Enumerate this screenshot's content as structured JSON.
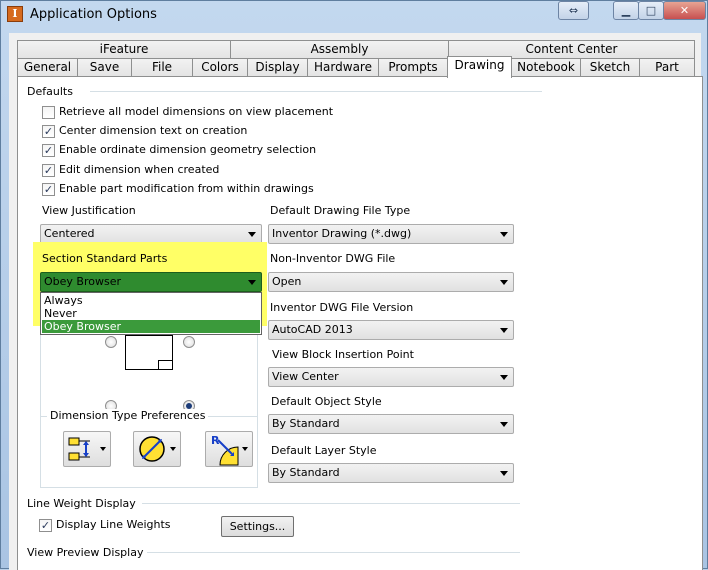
{
  "window": {
    "title": "Application Options",
    "app_icon": "I"
  },
  "caption": {
    "restore_glyph": "⇔",
    "minimize_glyph": "▁",
    "maximize_glyph": "□",
    "close_glyph": "✕"
  },
  "tabs_row1": [
    "iFeature",
    "Assembly",
    "Content Center"
  ],
  "tabs_row2": [
    "General",
    "Save",
    "File",
    "Colors",
    "Display",
    "Hardware",
    "Prompts",
    "Drawing",
    "Notebook",
    "Sketch",
    "Part"
  ],
  "active_tab": "Drawing",
  "defaults": {
    "group_label": "Defaults",
    "checkboxes": [
      {
        "label": "Retrieve all model dimensions on view placement",
        "checked": false
      },
      {
        "label": "Center dimension text on creation",
        "checked": true
      },
      {
        "label": "Enable ordinate dimension geometry selection",
        "checked": true
      },
      {
        "label": "Edit dimension when created",
        "checked": true
      },
      {
        "label": "Enable part modification from within drawings",
        "checked": true
      }
    ],
    "check_glyph": "✓"
  },
  "view_justification": {
    "label": "View Justification",
    "value": "Centered"
  },
  "section_standard_parts": {
    "label": "Section Standard Parts",
    "value": "Obey Browser",
    "options": [
      "Always",
      "Never",
      "Obey Browser"
    ],
    "highlight_color": "#ffff66",
    "selected_color": "#3b9a3b"
  },
  "default_drawing_file_type": {
    "label": "Default Drawing File Type",
    "value": "Inventor Drawing (*.dwg)"
  },
  "non_inventor_dwg_file": {
    "label": "Non-Inventor DWG File",
    "value": "Open"
  },
  "inventor_dwg_file_version": {
    "label": "Inventor DWG File Version",
    "value": "AutoCAD 2013"
  },
  "view_block_insertion_point": {
    "label": "View Block Insertion Point",
    "value": "View Center"
  },
  "default_object_style": {
    "label": "Default Object Style",
    "value": "By Standard"
  },
  "default_layer_style": {
    "label": "Default Layer Style",
    "value": "By Standard"
  },
  "dimension_type_preferences": {
    "label": "Dimension Type Preferences"
  },
  "line_weight_display": {
    "group_label": "Line Weight Display",
    "checkbox_label": "Display Line Weights",
    "checked": true,
    "settings_button": "Settings..."
  },
  "view_preview_display": {
    "group_label": "View Preview Display"
  }
}
